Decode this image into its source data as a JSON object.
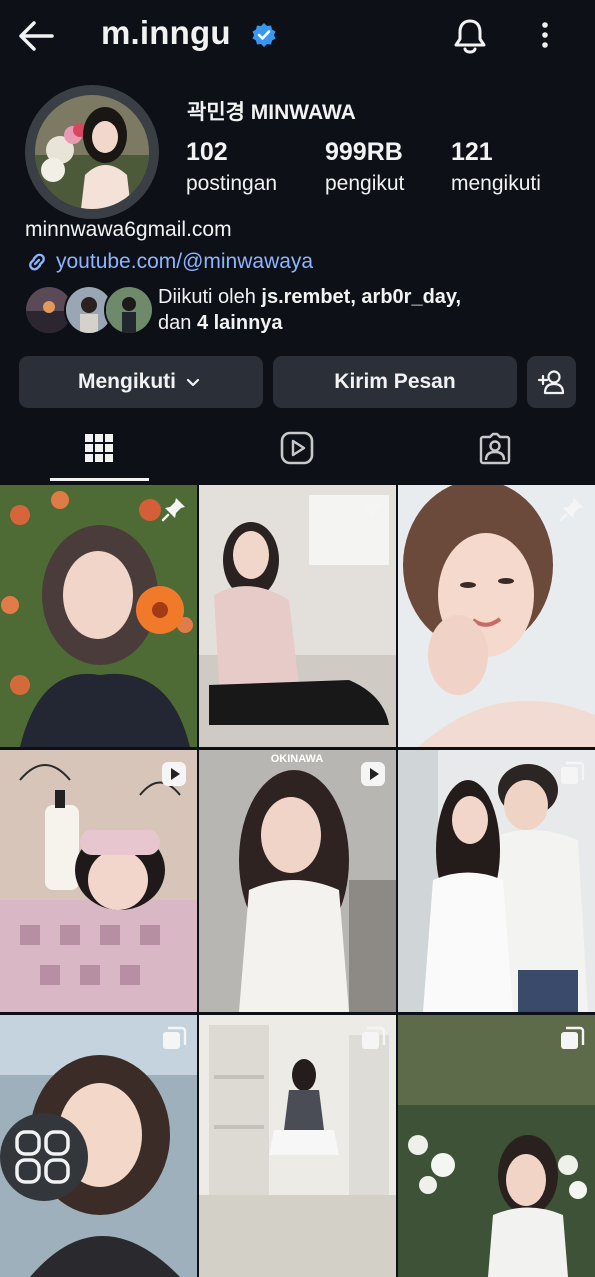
{
  "header": {
    "username": "m.inngu",
    "icons": {
      "back": "arrow-left-icon",
      "verified": "verified-badge-icon",
      "notifications": "bell-icon",
      "more": "more-vertical-icon"
    }
  },
  "profile": {
    "display_name": "곽민경 MINWAWA",
    "stats": [
      {
        "value": "102",
        "label": "postingan"
      },
      {
        "value": "999RB",
        "label": "pengikut"
      },
      {
        "value": "121",
        "label": "mengikuti"
      }
    ],
    "email": "minnwawa6gmail.com",
    "link": "youtube.com/@minwawaya",
    "followed_by": {
      "prefix": "Diikuti oleh ",
      "names": "js.rembet, arb0r_day,",
      "suffix_prefix": "dan ",
      "others": "4 lainnya"
    }
  },
  "actions": {
    "follow_label": "Mengikuti",
    "message_label": "Kirim Pesan",
    "add_icon": "add-person-icon"
  },
  "tabs": [
    {
      "name": "posts",
      "icon": "grid-icon",
      "active": true
    },
    {
      "name": "reels",
      "icon": "reels-icon",
      "active": false
    },
    {
      "name": "tagged",
      "icon": "tagged-person-icon",
      "active": false
    }
  ],
  "grid": {
    "posts": [
      {
        "badge": "pin-icon"
      },
      {
        "badge": "pin-icon"
      },
      {
        "badge": "pin-icon"
      },
      {
        "badge": "reel-icon"
      },
      {
        "badge": "reel-icon",
        "caption": "OKINAWA"
      },
      {
        "badge": "carousel-icon"
      },
      {
        "badge": "carousel-icon"
      },
      {
        "badge": "carousel-icon"
      },
      {
        "badge": "carousel-icon"
      }
    ]
  },
  "floating_icon": "apps-grid-icon",
  "colors": {
    "background": "#0d1117",
    "button": "#2b3038",
    "link": "#8eb4ff",
    "verified": "#3897f0"
  }
}
